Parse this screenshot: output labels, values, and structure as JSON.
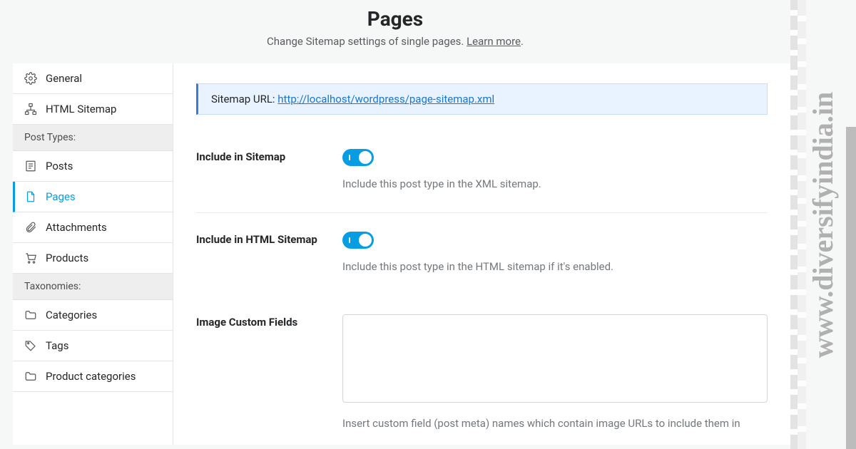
{
  "header": {
    "title": "Pages",
    "subtitle_pre": "Change Sitemap settings of single pages. ",
    "learn_more": "Learn more",
    "subtitle_post": "."
  },
  "sidebar": {
    "general": "General",
    "html_sitemap": "HTML Sitemap",
    "post_types_header": "Post Types:",
    "posts": "Posts",
    "pages": "Pages",
    "attachments": "Attachments",
    "products": "Products",
    "taxonomies_header": "Taxonomies:",
    "categories": "Categories",
    "tags": "Tags",
    "product_categories": "Product categories"
  },
  "notice": {
    "label": "Sitemap URL: ",
    "url": "http://localhost/wordpress/page-sitemap.xml"
  },
  "settings": {
    "include_sitemap": {
      "label": "Include in Sitemap",
      "desc": "Include this post type in the XML sitemap."
    },
    "include_html_sitemap": {
      "label": "Include in HTML Sitemap",
      "desc": "Include this post type in the HTML sitemap if it's enabled."
    },
    "image_custom_fields": {
      "label": "Image Custom Fields",
      "desc": "Insert custom field (post meta) names which contain image URLs to include them in"
    }
  },
  "watermark": "www.diversifyindia.in"
}
